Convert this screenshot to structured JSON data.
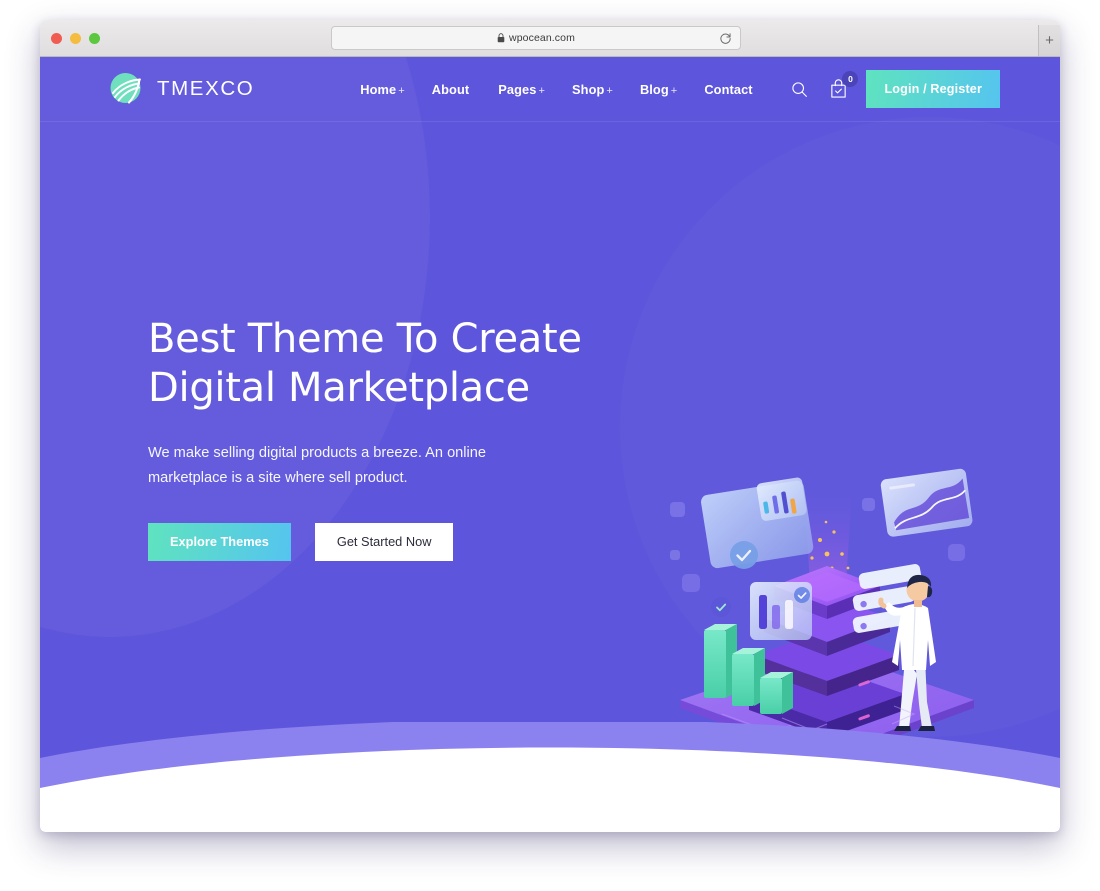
{
  "browser": {
    "url": "wpocean.com",
    "lock_icon": "lock-icon",
    "reload_icon": "reload-icon",
    "newtab_label": "+",
    "traffic_lights": [
      "close-red",
      "minimize-yellow",
      "maximize-green"
    ]
  },
  "site": {
    "brand": {
      "name": "TMEXCO",
      "logo_icon": "tmexco-swoosh-logo"
    },
    "nav": {
      "items": [
        {
          "label": "Home",
          "has_submenu": true,
          "plus": "+"
        },
        {
          "label": "About",
          "has_submenu": false,
          "plus": ""
        },
        {
          "label": "Pages",
          "has_submenu": true,
          "plus": "+"
        },
        {
          "label": "Shop",
          "has_submenu": true,
          "plus": "+"
        },
        {
          "label": "Blog",
          "has_submenu": true,
          "plus": "+"
        },
        {
          "label": "Contact",
          "has_submenu": false,
          "plus": ""
        }
      ],
      "search_icon": "search-icon",
      "cart_icon": "shopping-bag-check-icon",
      "cart_count": "0",
      "login_label": "Login / Register"
    },
    "hero": {
      "title_line1": "Best Theme To Create",
      "title_line2": "Digital Marketplace",
      "subtitle": "We make selling digital products a breeze. An online marketplace is a site where sell product.",
      "primary_cta": "Explore Themes",
      "secondary_cta": "Get Started Now",
      "illustration_name": "isometric-data-server-marketplace-illustration"
    }
  },
  "colors": {
    "hero_purple": "#5d55db",
    "hero_purple_dark": "#4a3fc2",
    "wave_light": "#8b82f0",
    "wave_white": "#ffffff",
    "accent_mint": "#5fe3bf",
    "accent_blue": "#55c4ef",
    "logo_mint": "#6fdfbe",
    "text_white": "#ffffff",
    "cta_dark_text": "#2c2c3d"
  }
}
